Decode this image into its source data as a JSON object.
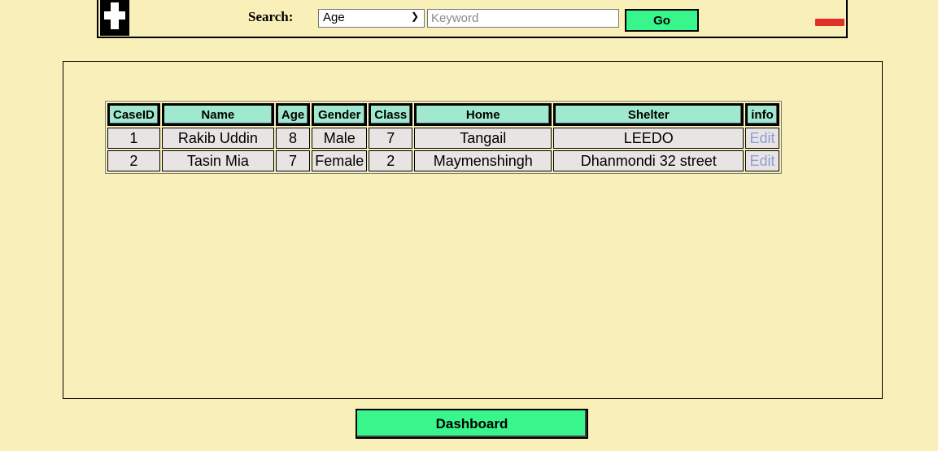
{
  "search": {
    "label": "Search:",
    "field_selected": "Age",
    "keyword_placeholder": "Keyword",
    "go_label": "Go"
  },
  "table": {
    "headers": [
      "CaseID",
      "Name",
      "Age",
      "Gender",
      "Class",
      "Home",
      "Shelter",
      "info"
    ],
    "rows": [
      [
        "1",
        "Rakib Uddin",
        "8",
        "Male",
        "7",
        "Tangail",
        "LEEDO",
        "Edit"
      ],
      [
        "2",
        "Tasin Mia",
        "7",
        "Female",
        "2",
        "Maymenshingh",
        "Dhanmondi 32 street",
        "Edit"
      ]
    ]
  },
  "footer": {
    "dashboard_label": "Dashboard"
  },
  "colors": {
    "page_bg": "#f9f0b9",
    "button_bg": "#38f58c",
    "header_bg": "#a0e8d0",
    "remove_icon": "#e32f2a",
    "edit_link": "#8da0d8"
  }
}
